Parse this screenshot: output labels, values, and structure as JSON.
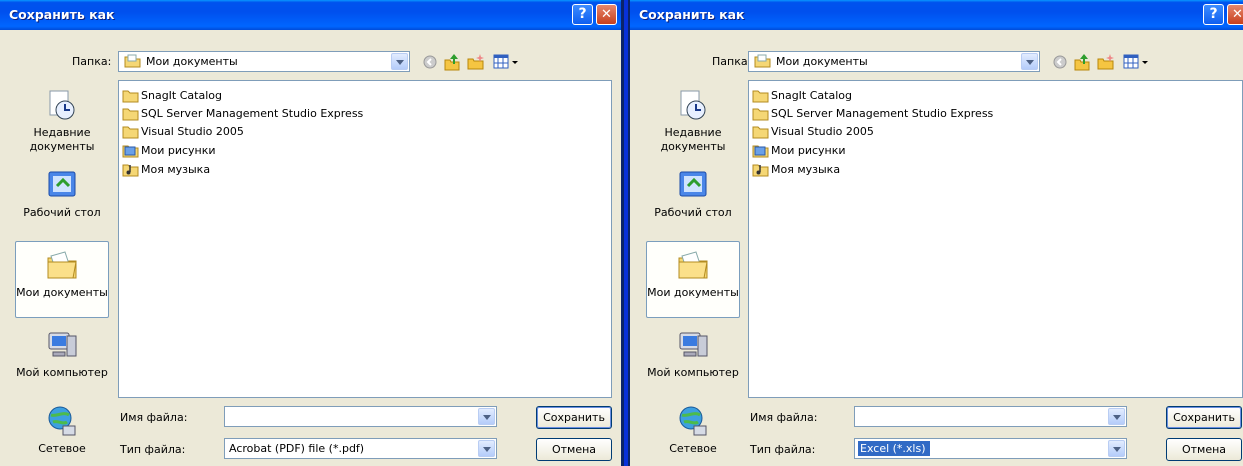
{
  "dialogs": [
    {
      "title": "Сохранить как",
      "folder_label": "Папка:",
      "folder_value": "Мои документы",
      "places": [
        {
          "label": "Недавние документы",
          "icon": "recent-documents-icon"
        },
        {
          "label": "Рабочий стол",
          "icon": "desktop-icon"
        },
        {
          "label": "Мои документы",
          "icon": "my-documents-icon",
          "active": true
        },
        {
          "label": "Мой компьютер",
          "icon": "my-computer-icon"
        },
        {
          "label": "Сетевое",
          "icon": "network-icon"
        }
      ],
      "files": [
        {
          "name": "SnagIt Catalog",
          "icon": "folder-icon"
        },
        {
          "name": "SQL Server Management Studio Express",
          "icon": "folder-icon"
        },
        {
          "name": "Visual Studio 2005",
          "icon": "folder-icon"
        },
        {
          "name": "Мои рисунки",
          "icon": "pictures-folder-icon"
        },
        {
          "name": "Моя музыка",
          "icon": "music-folder-icon"
        }
      ],
      "filename_label": "Имя файла:",
      "filename_value": "",
      "filetype_label": "Тип файла:",
      "filetype_value": "Acrobat (PDF) file (*.pdf)",
      "save_label": "Сохранить",
      "cancel_label": "Отмена"
    },
    {
      "title": "Сохранить как",
      "folder_label": "Папка:",
      "folder_value": "Мои документы",
      "places": [
        {
          "label": "Недавние документы",
          "icon": "recent-documents-icon"
        },
        {
          "label": "Рабочий стол",
          "icon": "desktop-icon"
        },
        {
          "label": "Мои документы",
          "icon": "my-documents-icon",
          "active": true
        },
        {
          "label": "Мой компьютер",
          "icon": "my-computer-icon"
        },
        {
          "label": "Сетевое",
          "icon": "network-icon"
        }
      ],
      "files": [
        {
          "name": "SnagIt Catalog",
          "icon": "folder-icon"
        },
        {
          "name": "SQL Server Management Studio Express",
          "icon": "folder-icon"
        },
        {
          "name": "Visual Studio 2005",
          "icon": "folder-icon"
        },
        {
          "name": "Мои рисунки",
          "icon": "pictures-folder-icon"
        },
        {
          "name": "Моя музыка",
          "icon": "music-folder-icon"
        }
      ],
      "filename_label": "Имя файла:",
      "filename_value": "",
      "filetype_label": "Тип файла:",
      "filetype_value": "Excel (*.xls)",
      "filetype_selected": true,
      "save_label": "Сохранить",
      "cancel_label": "Отмена"
    }
  ],
  "colors": {
    "titlebar": "#0054e3",
    "dialog_bg": "#ece9d8",
    "selection": "#316ac5",
    "field_border": "#7f9db9"
  }
}
